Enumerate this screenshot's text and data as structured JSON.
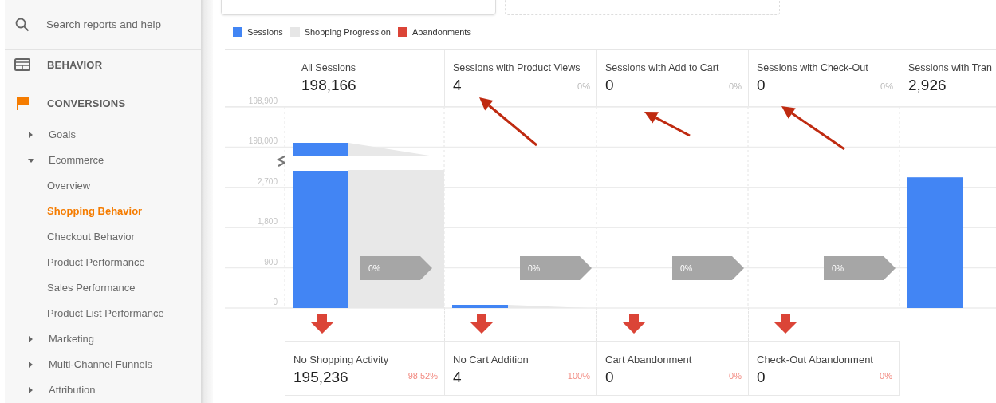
{
  "sidebar": {
    "search": {
      "placeholder": "Search reports and help"
    },
    "sections": [
      {
        "label": "BEHAVIOR",
        "active": false
      },
      {
        "label": "CONVERSIONS",
        "active": true
      }
    ],
    "items": [
      {
        "label": "Goals",
        "expanded": false,
        "selected": false
      },
      {
        "label": "Ecommerce",
        "expanded": true,
        "selected": false,
        "children": [
          {
            "label": "Overview",
            "selected": false
          },
          {
            "label": "Shopping Behavior",
            "selected": true
          },
          {
            "label": "Checkout Behavior",
            "selected": false
          },
          {
            "label": "Product Performance",
            "selected": false
          },
          {
            "label": "Sales Performance",
            "selected": false
          },
          {
            "label": "Product List Performance",
            "selected": false
          }
        ]
      },
      {
        "label": "Marketing",
        "expanded": false,
        "selected": false
      },
      {
        "label": "Multi-Channel Funnels",
        "expanded": false,
        "selected": false
      },
      {
        "label": "Attribution",
        "expanded": false,
        "selected": false
      }
    ]
  },
  "legend": [
    {
      "label": "Sessions",
      "color": "#4285f4"
    },
    {
      "label": "Shopping Progression",
      "color": "#e6e6e6"
    },
    {
      "label": "Abandonments",
      "color": "#db4437"
    }
  ],
  "funnel": {
    "axis_labels": [
      "198,900",
      "198,000",
      "2,700",
      "1,800",
      "900",
      "0"
    ],
    "stages": [
      {
        "title": "All Sessions",
        "value": "198,166",
        "progress": "0%"
      },
      {
        "title": "Sessions with Product Views",
        "value": "4",
        "percent": "0%",
        "progress": "0%"
      },
      {
        "title": "Sessions with Add to Cart",
        "value": "0",
        "percent": "0%",
        "progress": "0%"
      },
      {
        "title": "Sessions with Check-Out",
        "value": "0",
        "percent": "0%",
        "progress": "0%"
      },
      {
        "title": "Sessions with Tran",
        "value": "2,926"
      }
    ],
    "abandonments": [
      {
        "title": "No Shopping Activity",
        "value": "195,236",
        "percent": "98.52%"
      },
      {
        "title": "No Cart Addition",
        "value": "4",
        "percent": "100%"
      },
      {
        "title": "Cart Abandonment",
        "value": "0",
        "percent": "0%"
      },
      {
        "title": "Check-Out Abandonment",
        "value": "0",
        "percent": "0%"
      }
    ]
  }
}
